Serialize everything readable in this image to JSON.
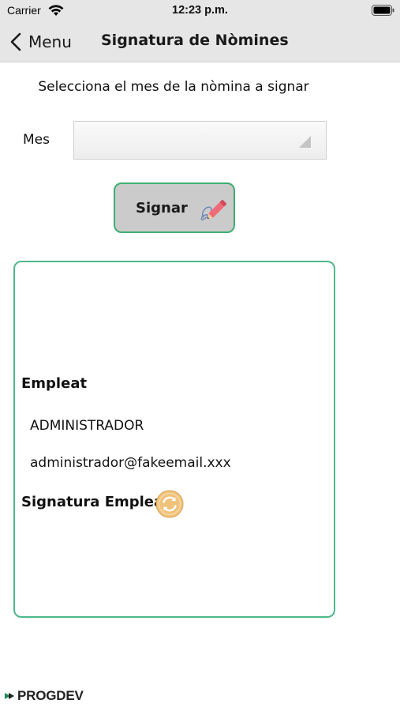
{
  "status_bar": {
    "carrier": "Carrier",
    "time": "12:23 p.m."
  },
  "nav": {
    "back_label": "Menu",
    "title": "Signatura de Nòmines"
  },
  "form": {
    "prompt": "Selecciona el mes de la nòmina a signar",
    "month_label": "Mes",
    "month_value": ""
  },
  "sign_button": {
    "label": "Signar"
  },
  "employee": {
    "heading": "Empleat",
    "name": "ADMINISTRADOR",
    "email": "administrador@fakeemail.xxx",
    "signature_heading": "Signatura Empleat"
  },
  "logo_text": "PROGDEV",
  "icons": {
    "wifi": "wifi-icon",
    "battery": "battery-icon",
    "back": "chevron-left-icon",
    "select_arrow": "triangle-down-icon",
    "pen": "pen-signature-icon",
    "refresh": "refresh-icon"
  },
  "colors": {
    "accent_green": "#3fae73",
    "bar_gray": "#e6e6e6",
    "button_gray": "#cbcbcb",
    "refresh_orange": "#f0c27a"
  }
}
